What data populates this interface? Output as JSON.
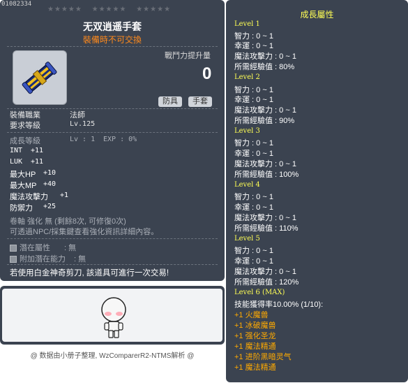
{
  "item_id": "01082334",
  "stars": [
    "★★★★★",
    "★★★★★",
    "★★★★★"
  ],
  "title": "无双逍遥手套",
  "warning": "裝備時不可交換",
  "power": {
    "label": "戰鬥力提升量",
    "value": "0"
  },
  "tags": [
    "防具",
    "手套"
  ],
  "job": {
    "label": "裝備職業",
    "value": "法師"
  },
  "req_level": {
    "label": "要求等級",
    "value": "Lv.125"
  },
  "growth": {
    "label": "成長等級",
    "lv": "Lv : 1",
    "exp": "EXP : 0%"
  },
  "stats": [
    {
      "name": "INT",
      "value": "+11"
    },
    {
      "name": "LUK",
      "value": "+11"
    },
    {
      "name": "最大HP",
      "value": "+10"
    },
    {
      "name": "最大MP",
      "value": "+40"
    },
    {
      "name": "魔法攻擊力",
      "value": "+1"
    },
    {
      "name": "防禦力",
      "value": "+25"
    }
  ],
  "scroll_line1": "卷軸 強化 無 (剩餘8次, 可修復0次)",
  "scroll_line2": "可透過NPC/採集鍵查看強化資訊詳細內容。",
  "potential": {
    "label": "潛在屬性",
    "value": ": 無"
  },
  "bonus_potential": {
    "label": "附加潛在能力",
    "value": ": 無"
  },
  "trade_note": "若使用白金神奇剪刀, 該道具可進行一次交易!",
  "credit": "@ 数据由小册子整理, WzComparerR2-NTMS解析 @",
  "growth_panel": {
    "title": "成長屬性",
    "levels": [
      {
        "name": "Level 1",
        "lines": [
          "智力 : 0 ~ 1",
          "幸運 : 0 ~ 1",
          "魔法攻擊力 : 0 ~ 1",
          "所需經驗值 : 80%"
        ]
      },
      {
        "name": "Level 2",
        "lines": [
          "智力 : 0 ~ 1",
          "幸運 : 0 ~ 1",
          "魔法攻擊力 : 0 ~ 1",
          "所需經驗值 : 90%"
        ]
      },
      {
        "name": "Level 3",
        "lines": [
          "智力 : 0 ~ 1",
          "幸運 : 0 ~ 1",
          "魔法攻擊力 : 0 ~ 1",
          "所需經驗值 : 100%"
        ]
      },
      {
        "name": "Level 4",
        "lines": [
          "智力 : 0 ~ 1",
          "幸運 : 0 ~ 1",
          "魔法攻擊力 : 0 ~ 1",
          "所需經驗值 : 110%"
        ]
      },
      {
        "name": "Level 5",
        "lines": [
          "智力 : 0 ~ 1",
          "幸運 : 0 ~ 1",
          "魔法攻擊力 : 0 ~ 1",
          "所需經驗值 : 120%"
        ]
      }
    ],
    "max": {
      "name": "Level 6 (MAX)",
      "skill_rate": "技能獲得率10.00% (1/10):",
      "skills": [
        "+1 火魔兽",
        "+1 冰破魔兽",
        "+1 强化圣龙",
        "+1 魔法精通",
        "+1 进阶黑暗灵气",
        "+1 魔法精通"
      ]
    }
  },
  "colors": {
    "panel": "#3b4350",
    "accent_yellow": "#ffff55",
    "accent_orange": "#ffaa00",
    "warn": "#ff8a1c"
  }
}
